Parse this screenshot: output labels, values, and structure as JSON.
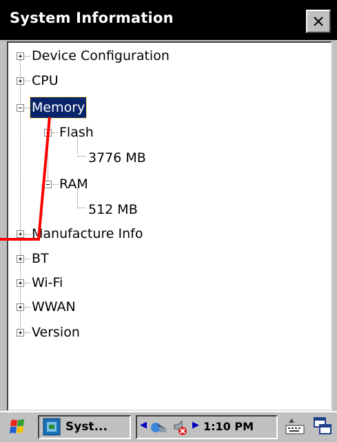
{
  "window": {
    "title": "System Information",
    "close_label": "×"
  },
  "tree": {
    "nodes": [
      {
        "label": "Device Configuration",
        "expanded": false
      },
      {
        "label": "CPU",
        "expanded": false
      },
      {
        "label": "Memory",
        "expanded": true,
        "selected": true
      },
      {
        "label": "Flash",
        "expanded": true
      },
      {
        "label": "3776 MB"
      },
      {
        "label": "RAM",
        "expanded": true
      },
      {
        "label": "512 MB"
      },
      {
        "label": "Manufacture Info",
        "expanded": false
      },
      {
        "label": "BT",
        "expanded": false
      },
      {
        "label": "Wi-Fi",
        "expanded": false
      },
      {
        "label": "WWAN",
        "expanded": false
      },
      {
        "label": "Version",
        "expanded": false
      }
    ]
  },
  "taskbar": {
    "task_label": "Syst...",
    "clock": "1:10 PM",
    "icons": [
      "start-flag-icon",
      "app-window-icon",
      "left-arrow-icon",
      "network-icon",
      "volume-muted-icon",
      "right-arrow-icon",
      "keyboard-icon",
      "window-switch-icon"
    ]
  },
  "colors": {
    "selection": "#0a246a",
    "annotation": "#ff0000",
    "titlebar": "#000000",
    "chrome": "#c0c0c0"
  }
}
